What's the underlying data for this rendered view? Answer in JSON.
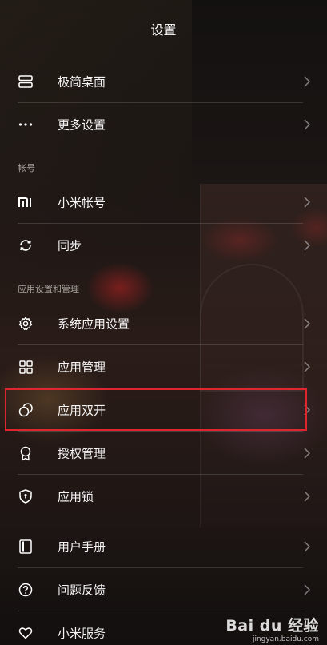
{
  "header": {
    "title": "设置"
  },
  "sections": {
    "account": "帐号",
    "apps": "应用设置和管理"
  },
  "items": [
    {
      "label": "极简桌面",
      "icon": "simple-desktop-icon"
    },
    {
      "label": "更多设置",
      "icon": "more-dots-icon"
    },
    {
      "label": "小米帐号",
      "icon": "mi-logo-icon"
    },
    {
      "label": "同步",
      "icon": "sync-icon"
    },
    {
      "label": "系统应用设置",
      "icon": "gear-icon"
    },
    {
      "label": "应用管理",
      "icon": "grid-icon"
    },
    {
      "label": "应用双开",
      "icon": "dual-app-icon",
      "highlighted": true
    },
    {
      "label": "授权管理",
      "icon": "badge-icon"
    },
    {
      "label": "应用锁",
      "icon": "shield-lock-icon"
    },
    {
      "label": "用户手册",
      "icon": "book-icon"
    },
    {
      "label": "问题反馈",
      "icon": "question-icon"
    },
    {
      "label": "小米服务",
      "icon": "heart-icon"
    }
  ],
  "highlight_color": "#e0262d",
  "watermark": {
    "main": "Bai du 经验",
    "sub": "jingyan.baidu.com"
  }
}
